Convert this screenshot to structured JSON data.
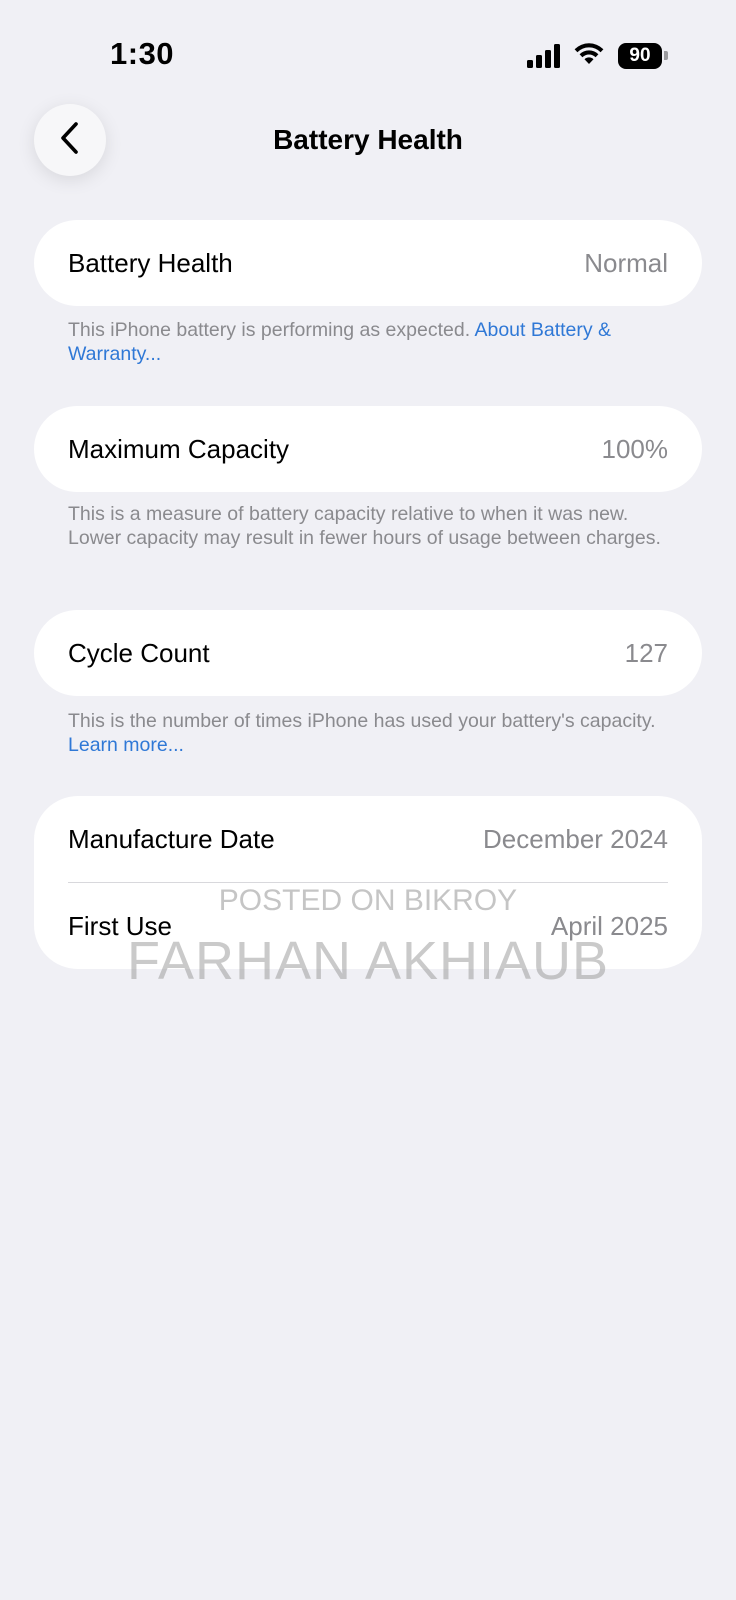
{
  "status_bar": {
    "time": "1:30",
    "battery_level": "90",
    "icons": [
      "signal-icon",
      "wifi-icon",
      "battery-icon"
    ]
  },
  "nav": {
    "title": "Battery Health",
    "back_icon": "chevron-left-icon"
  },
  "battery_health": {
    "label": "Battery Health",
    "value": "Normal",
    "note_text": "This iPhone battery is performing as expected. ",
    "note_link": "About Battery & Warranty..."
  },
  "maximum_capacity": {
    "label": "Maximum Capacity",
    "value": "100%",
    "note_text": "This is a measure of battery capacity relative to when it was new. Lower capacity may result in fewer hours of usage between charges."
  },
  "cycle_count": {
    "label": "Cycle Count",
    "value": "127",
    "note_text": "This is the number of times iPhone has used your battery's capacity. ",
    "note_link": "Learn more..."
  },
  "dates": {
    "manufacture_label": "Manufacture Date",
    "manufacture_value": "December 2024",
    "first_use_label": "First Use",
    "first_use_value": "April 2025"
  },
  "watermark": {
    "line1": "POSTED ON BIKROY",
    "line2": "FARHAN AKHIAUB"
  },
  "colors": {
    "background": "#f0f0f5",
    "card": "#ffffff",
    "secondary_text": "#8a8a8e",
    "link": "#2f78d6"
  }
}
